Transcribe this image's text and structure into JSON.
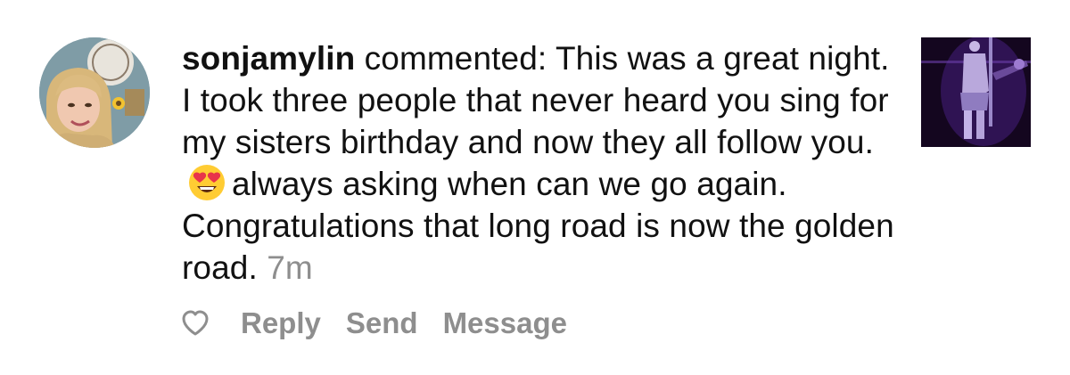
{
  "comment": {
    "username": "sonjamylin",
    "verb": "commented:",
    "text_before_emoji": "This was a great night. I took three people that never heard you sing for my sisters birthday and now they all follow you.",
    "emoji": "heart-eyes-emoji",
    "text_after_emoji": "always asking when can we go again. Congratulations that long road is now the golden road.",
    "timestamp": "7m"
  },
  "actions": {
    "like_icon": "heart-outline-icon",
    "reply_label": "Reply",
    "send_label": "Send",
    "message_label": "Message"
  },
  "colors": {
    "text": "#111111",
    "muted": "#8e8e8e",
    "thumbnail_bg": "#12051f",
    "emoji_face": "#ffcc33",
    "emoji_heart": "#e8334a"
  }
}
